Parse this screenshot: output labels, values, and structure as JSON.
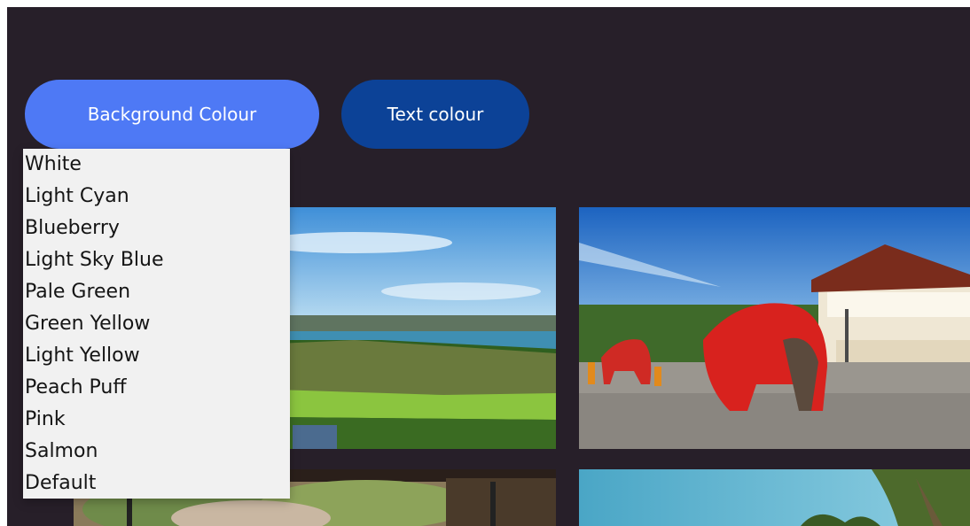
{
  "buttons": {
    "background_colour": "Background Colour",
    "text_colour": "Text colour"
  },
  "dropdown": {
    "options": [
      "White",
      "Light Cyan",
      "Blueberry",
      "Light Sky Blue",
      "Pale Green",
      "Green Yellow",
      "Light Yellow",
      "Peach Puff",
      "Pink",
      "Salmon",
      "Default"
    ]
  },
  "colors": {
    "page_background": "#271f29",
    "primary_button": "#4e79f5",
    "secondary_button": "#0c4297",
    "dropdown_background": "#f1f1f1"
  },
  "gallery": {
    "images": [
      "galle-fort-photo",
      "temple-elephants-photo",
      "street-market-photo",
      "beach-palms-photo"
    ]
  }
}
